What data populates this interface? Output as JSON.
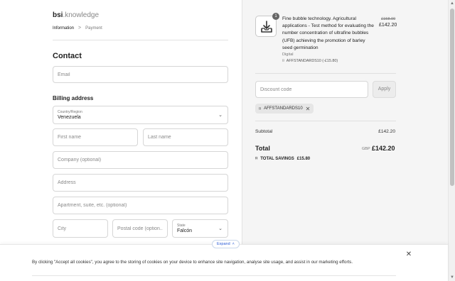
{
  "brand": {
    "bold": "bsi",
    "rest": ".knowledge"
  },
  "breadcrumb": {
    "current": "Information",
    "separator": ">",
    "next": "Payment"
  },
  "contact": {
    "heading": "Contact",
    "email_placeholder": "Email"
  },
  "billing": {
    "heading": "Billing address",
    "country_label": "Country/Region",
    "country_value": "Venezuela",
    "first_name_placeholder": "First name",
    "last_name_placeholder": "Last name",
    "company_placeholder": "Company (optional)",
    "address_placeholder": "Address",
    "apartment_placeholder": "Apartment, suite, etc. (optional)",
    "city_placeholder": "City",
    "postal_placeholder": "Postal code (option...",
    "state_label": "State",
    "state_value": "Falcón"
  },
  "expand": {
    "label": "Expand",
    "icon": "chevron-up-icon"
  },
  "cookie": {
    "text": "By clicking \"Accept all cookies\", you agree to the storing of cookies on your device to enhance site navigation, analyse site usage, and assist in our marketing efforts.",
    "close": "✕"
  },
  "order": {
    "item": {
      "quantity": "1",
      "title": "Fine bubble technology. Agricultural applications - Test method for evaluating the number concentration of ultrafine bubbles (UFB) achieving the promotion of barley seed germination",
      "type": "Digital",
      "discount": "AFFSTANDARDS10 (-£15.80)",
      "old_price": "£158.00",
      "price": "£142.20",
      "icon": "download-tray-icon"
    },
    "discount_code": {
      "placeholder": "Discount code",
      "apply_label": "Apply"
    },
    "applied_tag": {
      "code": "AFFSTANDARDS10",
      "remove": "✕"
    },
    "subtotal": {
      "label": "Subtotal",
      "value": "£142.20"
    },
    "total": {
      "label": "Total",
      "currency": "GBP",
      "value": "£142.20"
    },
    "savings": {
      "label": "TOTAL SAVINGS",
      "value": "£15.80"
    }
  },
  "scrollbar": {
    "up": "▲",
    "down": "▼"
  }
}
